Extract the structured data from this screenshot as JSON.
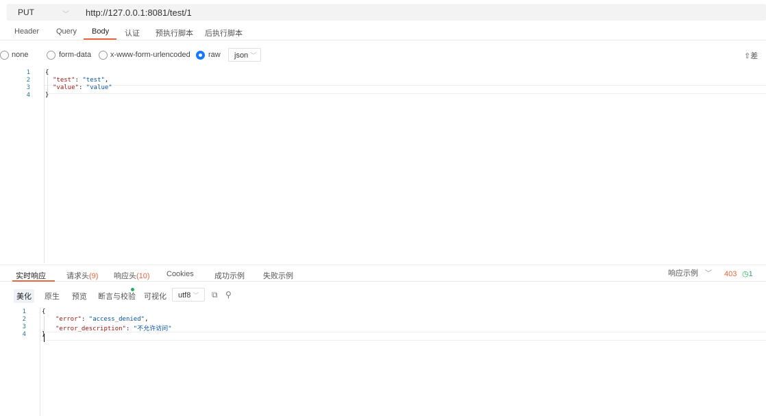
{
  "request": {
    "method": "PUT",
    "url": "http://127.0.0.1:8081/test/1"
  },
  "request_tabs": [
    "Header",
    "Query",
    "Body",
    "认证",
    "预执行脚本",
    "后执行脚本"
  ],
  "body_types": {
    "none": "none",
    "form_data": "form-data",
    "urlencoded": "x-www-form-urlencoded",
    "raw": "raw",
    "format": "json",
    "upload_label": "⇧差"
  },
  "request_body": {
    "lines": [
      "1",
      "2",
      "3",
      "4"
    ],
    "open": "{",
    "k1": "\"test\"",
    "v1": "\"test\"",
    "k2": "\"value\"",
    "v2": "\"value\"",
    "close": "}"
  },
  "response_tabs": {
    "realtime": "实时响应",
    "req_headers": "请求头",
    "req_headers_count": "(9)",
    "resp_headers": "响应头",
    "resp_headers_count": "(10)",
    "cookies": "Cookies",
    "success_example": "成功示例",
    "fail_example": "失败示例",
    "resp_example": "响应示例",
    "status_code": "403",
    "time_prefix": "◷1"
  },
  "response_tools": {
    "beautify": "美化",
    "raw": "原生",
    "preview": "预览",
    "assert": "断言与校验",
    "visualize": "可视化",
    "charset": "utf8"
  },
  "response_body": {
    "lines": [
      "1",
      "2",
      "3",
      "4"
    ],
    "open": "{",
    "k1": "\"error\"",
    "v1": "\"access_denied\"",
    "k2": "\"error_description\"",
    "v2": "\"不允许访问\"",
    "close": "}"
  },
  "colors": {
    "accent": "#e8643c",
    "radio_active": "#1677ff",
    "success": "#27ae60"
  }
}
